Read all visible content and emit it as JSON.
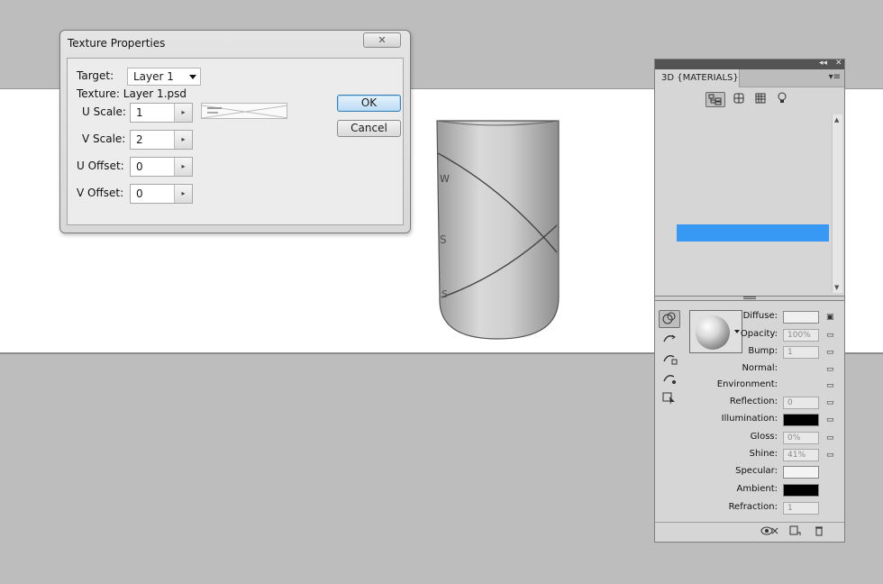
{
  "dialog": {
    "title": "Texture Properties",
    "close_glyph": "✕",
    "target_label": "Target:",
    "target_value": "Layer 1",
    "texture_label": "Texture: Layer 1.psd",
    "u_scale_label": "U Scale:",
    "u_scale_value": "1",
    "v_scale_label": "V Scale:",
    "v_scale_value": "2",
    "u_offset_label": "U Offset:",
    "u_offset_value": "0",
    "v_offset_label": "V Offset:",
    "v_offset_value": "0",
    "ok_label": "OK",
    "cancel_label": "Cancel",
    "spin_glyph": "▸"
  },
  "panel": {
    "collapse_glyph": "◂◂",
    "close_glyph": "✕",
    "tab_label": "3D {MATERIALS}",
    "menu_glyph": "▾≡",
    "filter_icons": [
      "scene-icon",
      "mesh-icon",
      "materials-icon",
      "light-icon"
    ],
    "properties": {
      "diffuse_label": "Diffuse:",
      "opacity_label": "Opacity:",
      "opacity_value": "100%",
      "bump_label": "Bump:",
      "bump_value": "1",
      "normal_label": "Normal:",
      "environment_label": "Environment:",
      "reflection_label": "Reflection:",
      "reflection_value": "0",
      "illumination_label": "Illumination:",
      "gloss_label": "Gloss:",
      "gloss_value": "0%",
      "shine_label": "Shine:",
      "shine_value": "41%",
      "specular_label": "Specular:",
      "ambient_label": "Ambient:",
      "refraction_label": "Refraction:",
      "refraction_value": "1"
    },
    "colors": {
      "diffuse": "#f0f0f0",
      "illumination": "#000000",
      "specular": "#f4f4f4",
      "ambient": "#000000",
      "selection": "#3899f5"
    }
  }
}
